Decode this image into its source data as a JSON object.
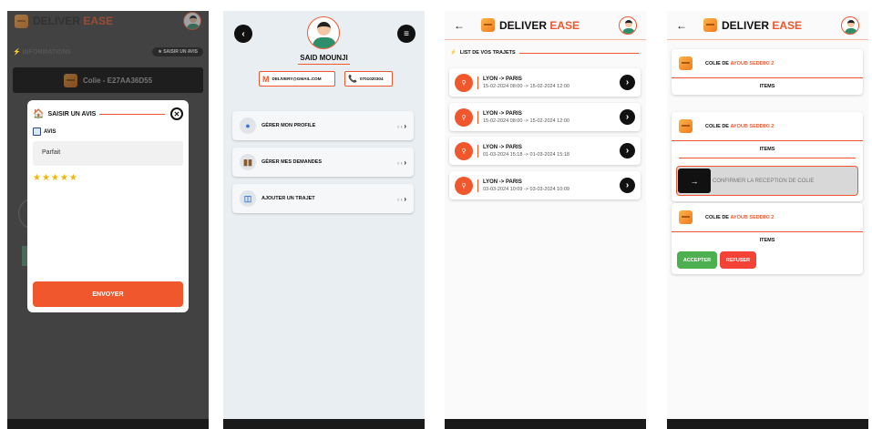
{
  "app": {
    "logo_part1": "DELIVER",
    "logo_part2": "EASE"
  },
  "screen1": {
    "informations_label": "INFORMATIONS",
    "saisir_pill": "SAISIR UN AVIS",
    "colie_label": "Colie - E27AA36D55",
    "modal": {
      "title": "SAISIR UN AVIS",
      "avis_label": "AVIS",
      "input_value": "Parfait",
      "stars": "★★★★★",
      "rating": 5,
      "send_label": "ENVOYER"
    }
  },
  "screen2": {
    "name": "SAID MOUNJI",
    "email": "DELIVERY@GMAIL.COM",
    "phone": "0701020304",
    "menu": [
      {
        "label": "GÉRER MON PROFILE"
      },
      {
        "label": "GÉRER MES DEMANDES"
      },
      {
        "label": "AJOUTER UN TRAJET"
      }
    ]
  },
  "screen3": {
    "list_title": "LIST DE VOS TRAJETS",
    "trips": [
      {
        "route": "LYON -> PARIS",
        "dates": "15-02-2024 08:00 -> 15-02-2024 12:00"
      },
      {
        "route": "LYON -> PARIS",
        "dates": "15-02-2024 08:00 -> 15-02-2024 12:00"
      },
      {
        "route": "LYON -> PARIS",
        "dates": "01-03-2024 15:18 -> 01-03-2024 15:18"
      },
      {
        "route": "LYON -> PARIS",
        "dates": "03-03-2024 10:09 -> 03-03-2024 10:09"
      }
    ]
  },
  "screen4": {
    "cards": [
      {
        "prefix": "COLIE DE",
        "owner": "AYOUB SEDDIKI 2",
        "items": "ITEMS"
      },
      {
        "prefix": "COLIE DE",
        "owner": "AYOUB SEDDIKI 2",
        "items": "ITEMS",
        "confirm": "CONFIRMER LA RECEPTION  DE COLIE"
      },
      {
        "prefix": "COLIE DE",
        "owner": "AYOUB SEDDIKI 2",
        "items": "ITEMS",
        "accept": "ACCEPTER",
        "refuse": "REFUSER"
      }
    ]
  },
  "colors": {
    "accent": "#f0572c",
    "accept": "#4caf50",
    "refuse": "#f44336",
    "dark": "#111111"
  },
  "icons": [
    "back-icon",
    "menu-icon",
    "chevron-right-icon",
    "close-icon",
    "star-icon",
    "gmail-icon",
    "phone-icon",
    "box-logo-icon",
    "user-avatar-icon"
  ]
}
